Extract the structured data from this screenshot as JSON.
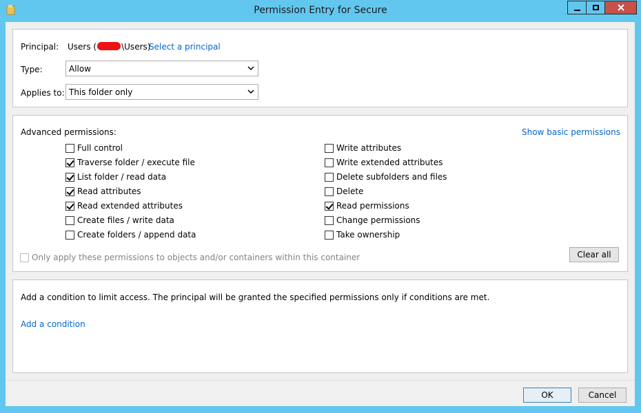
{
  "window": {
    "title": "Permission Entry for Secure",
    "icons": {
      "app": "folder-icon",
      "minimize": "minimize-icon",
      "maximize": "maximize-icon",
      "close": "close-icon"
    }
  },
  "principal": {
    "label": "Principal:",
    "value_prefix": "Users (",
    "value_suffix": "\\Users)",
    "select_link": "Select a principal"
  },
  "type": {
    "label": "Type:",
    "value": "Allow"
  },
  "applies_to": {
    "label": "Applies to:",
    "value": "This folder only"
  },
  "advanced": {
    "label": "Advanced permissions:",
    "toggle_link": "Show basic permissions",
    "left": [
      {
        "label": "Full control",
        "checked": false
      },
      {
        "label": "Traverse folder / execute file",
        "checked": true
      },
      {
        "label": "List folder / read data",
        "checked": true
      },
      {
        "label": "Read attributes",
        "checked": true
      },
      {
        "label": "Read extended attributes",
        "checked": true
      },
      {
        "label": "Create files / write data",
        "checked": false
      },
      {
        "label": "Create folders / append data",
        "checked": false
      }
    ],
    "right": [
      {
        "label": "Write attributes",
        "checked": false
      },
      {
        "label": "Write extended attributes",
        "checked": false
      },
      {
        "label": "Delete subfolders and files",
        "checked": false
      },
      {
        "label": "Delete",
        "checked": false
      },
      {
        "label": "Read permissions",
        "checked": true
      },
      {
        "label": "Change permissions",
        "checked": false
      },
      {
        "label": "Take ownership",
        "checked": false
      }
    ],
    "only_apply": {
      "label": "Only apply these permissions to objects and/or containers within this container",
      "checked": false,
      "disabled": true
    },
    "clear_all": "Clear all"
  },
  "condition": {
    "text": "Add a condition to limit access. The principal will be granted the specified permissions only if conditions are met.",
    "add_link": "Add a condition"
  },
  "footer": {
    "ok": "OK",
    "cancel": "Cancel"
  }
}
